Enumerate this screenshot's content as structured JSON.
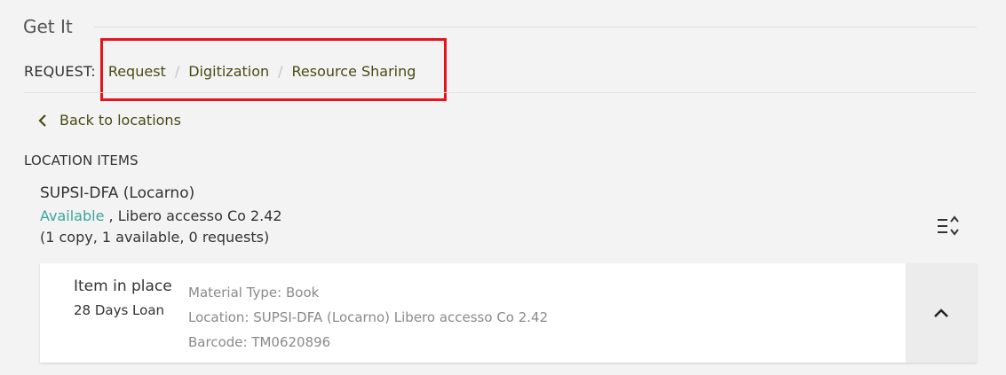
{
  "get_it": {
    "title": "Get It"
  },
  "request": {
    "label": "REQUEST:",
    "links": [
      "Request",
      "Digitization",
      "Resource Sharing"
    ],
    "highlight_color": "#e8121b"
  },
  "back": {
    "label": "Back to locations",
    "icon": "chevron-left-icon"
  },
  "location_items": {
    "heading": "LOCATION ITEMS",
    "location_name": "SUPSI-DFA (Locarno)",
    "availability": "Available",
    "availability_color": "#3aa59a",
    "shelf": ", Libero accesso Co 2.42",
    "counts": "(1 copy, 1 available, 0 requests)",
    "filter_icon": "sort-filter-icon"
  },
  "item": {
    "status": "Item in place",
    "policy": "28 Days Loan",
    "material_type": "Material Type: Book",
    "location": "Location: SUPSI-DFA (Locarno) Libero accesso Co 2.42",
    "barcode": "Barcode: TM0620896",
    "collapse_icon": "chevron-up-icon"
  }
}
